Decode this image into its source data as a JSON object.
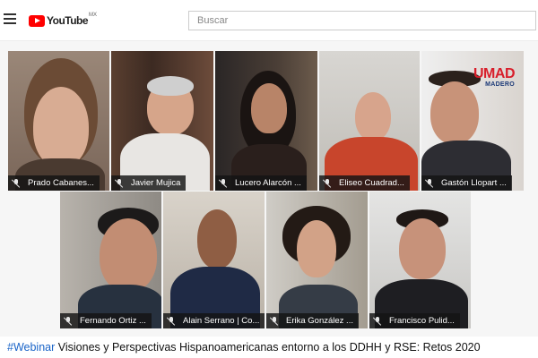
{
  "header": {
    "logo_text": "YouTube",
    "region": "MX",
    "search_placeholder": "Buscar",
    "menu_icon": "hamburger-icon"
  },
  "badge": {
    "main": "UMAD",
    "sub": "MADERO"
  },
  "participants": [
    {
      "name": "Prado Cabanes..."
    },
    {
      "name": "Javier Mujica"
    },
    {
      "name": "Lucero Alarcón ..."
    },
    {
      "name": "Eliseo Cuadrad..."
    },
    {
      "name": "Gastón Llopart ..."
    },
    {
      "name": "Fernando Ortiz ..."
    },
    {
      "name": "Alain Serrano | Co..."
    },
    {
      "name": "Erika González ..."
    },
    {
      "name": "Francisco Pulid..."
    }
  ],
  "video": {
    "hashtag": "#Webinar",
    "title_rest": " Visiones y Perspectivas Hispanoamericanas entorno a los DDHH y RSE: Retos 2020"
  }
}
